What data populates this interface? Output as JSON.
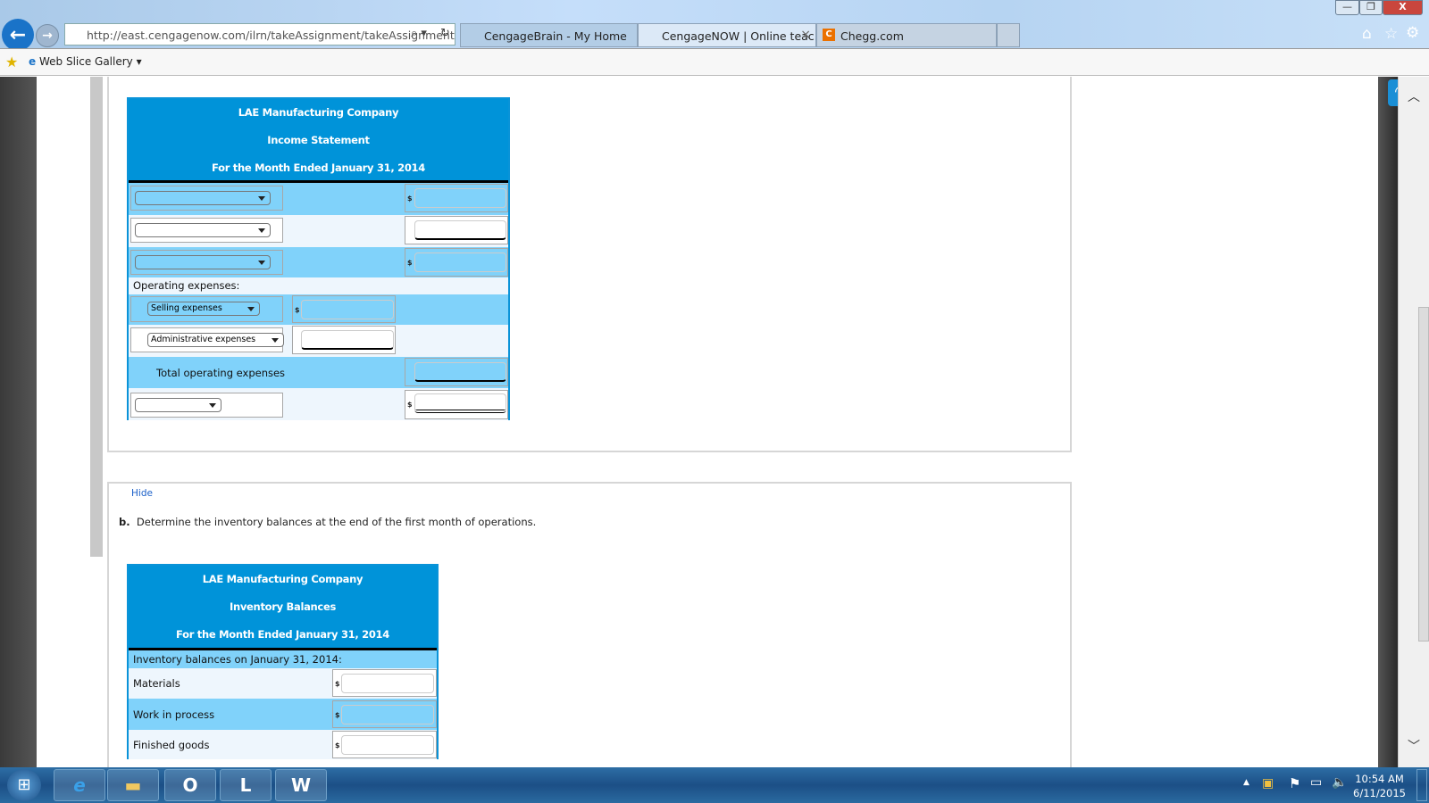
{
  "browser": {
    "url": "http://east.cengagenow.com/ilrn/takeAssignment/takeAssignmentl",
    "tabs": [
      {
        "label": "CengageBrain - My Home",
        "active": false
      },
      {
        "label": "CengageNOW | Online teac...",
        "active": true
      },
      {
        "label": "Chegg.com",
        "active": false
      }
    ],
    "tab_close": "×",
    "favorites": {
      "web_slice_gallery": "Web Slice Gallery"
    },
    "window_buttons": {
      "minimize": "—",
      "restore": "❐",
      "close": "X"
    }
  },
  "income_statement": {
    "company": "LAE Manufacturing Company",
    "title": "Income Statement",
    "period": "For the Month Ended January 31, 2014",
    "dollar": "$",
    "operating_expenses_label": "Operating expenses:",
    "selling_expenses": "Selling expenses",
    "administrative_expenses": "Administrative expenses",
    "total_operating_expenses": "Total operating expenses"
  },
  "part_b": {
    "hide_link": "Hide",
    "letter": "b.",
    "question": "Determine the inventory balances at the end of the first month of operations.",
    "company": "LAE Manufacturing Company",
    "title": "Inventory Balances",
    "period": "For the Month Ended January 31, 2014",
    "section_label": "Inventory balances on January 31, 2014:",
    "rows": [
      {
        "label": "Materials"
      },
      {
        "label": "Work in process"
      },
      {
        "label": "Finished goods"
      }
    ],
    "dollar": "$"
  },
  "taskbar": {
    "time": "10:54 AM",
    "date": "6/11/2015",
    "apps": [
      "internet-explorer",
      "file-explorer",
      "outlook",
      "lync",
      "word"
    ]
  },
  "colors": {
    "header_blue": "#0093d9",
    "row_blue": "#80d2fa",
    "row_light": "#eef6fd"
  }
}
